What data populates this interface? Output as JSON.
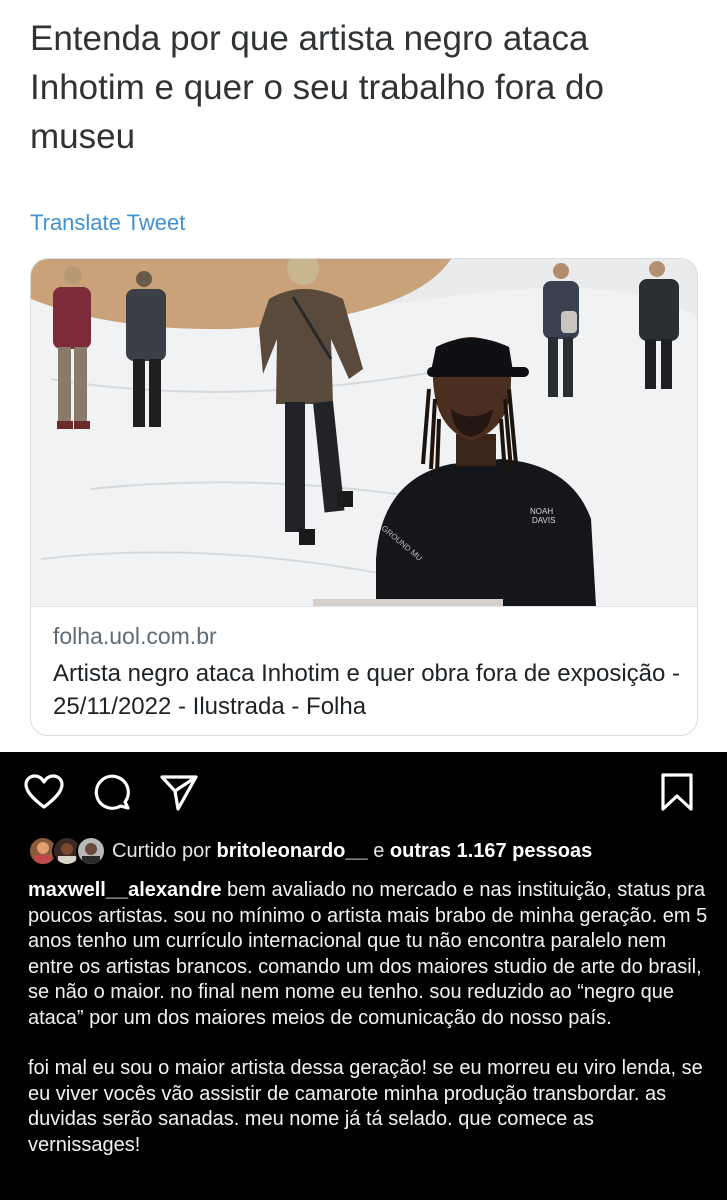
{
  "tweet": {
    "text": "Entenda por que artista negro ataca Inhotim e quer o seu trabalho fora do museu",
    "translate_label": "Translate Tweet",
    "card": {
      "domain": "folha.uol.com.br",
      "title": "Artista negro ataca Inhotim e quer obra fora de exposição - 25/11/2022 - Ilustrada - Folha",
      "image_shirt_text_1": "NOAH",
      "image_shirt_text_2": "DAVIS",
      "image_sleeve_text": "GROUND MU"
    }
  },
  "instagram": {
    "actions": {
      "like_icon": "heart-icon",
      "comment_icon": "comment-icon",
      "share_icon": "send-icon",
      "save_icon": "bookmark-icon"
    },
    "likes": {
      "prefix": "Curtido por",
      "user": "britoleonardo__",
      "connector": "e",
      "others": "outras 1.167 pessoas"
    },
    "caption": {
      "username": "maxwell__alexandre",
      "paragraph_1": "bem avaliado no mercado e nas instituição, status pra poucos artistas. sou no mínimo o artista mais brabo de minha geração. em 5 anos tenho um currículo internacional que tu não encontra paralelo nem entre os artistas brancos. comando um dos maiores studio de arte do brasil, se não o maior. no final nem nome eu tenho. sou reduzido ao “negro que ataca” por um dos maiores meios de comunicação do nosso país.",
      "paragraph_2": "foi mal eu sou o maior artista dessa geração! se eu morreu eu viro lenda, se eu viver vocês vão assistir de camarote minha produção transbordar. as duvidas serão sanadas. meu nome já tá selado. que comece as vernissages!"
    }
  }
}
